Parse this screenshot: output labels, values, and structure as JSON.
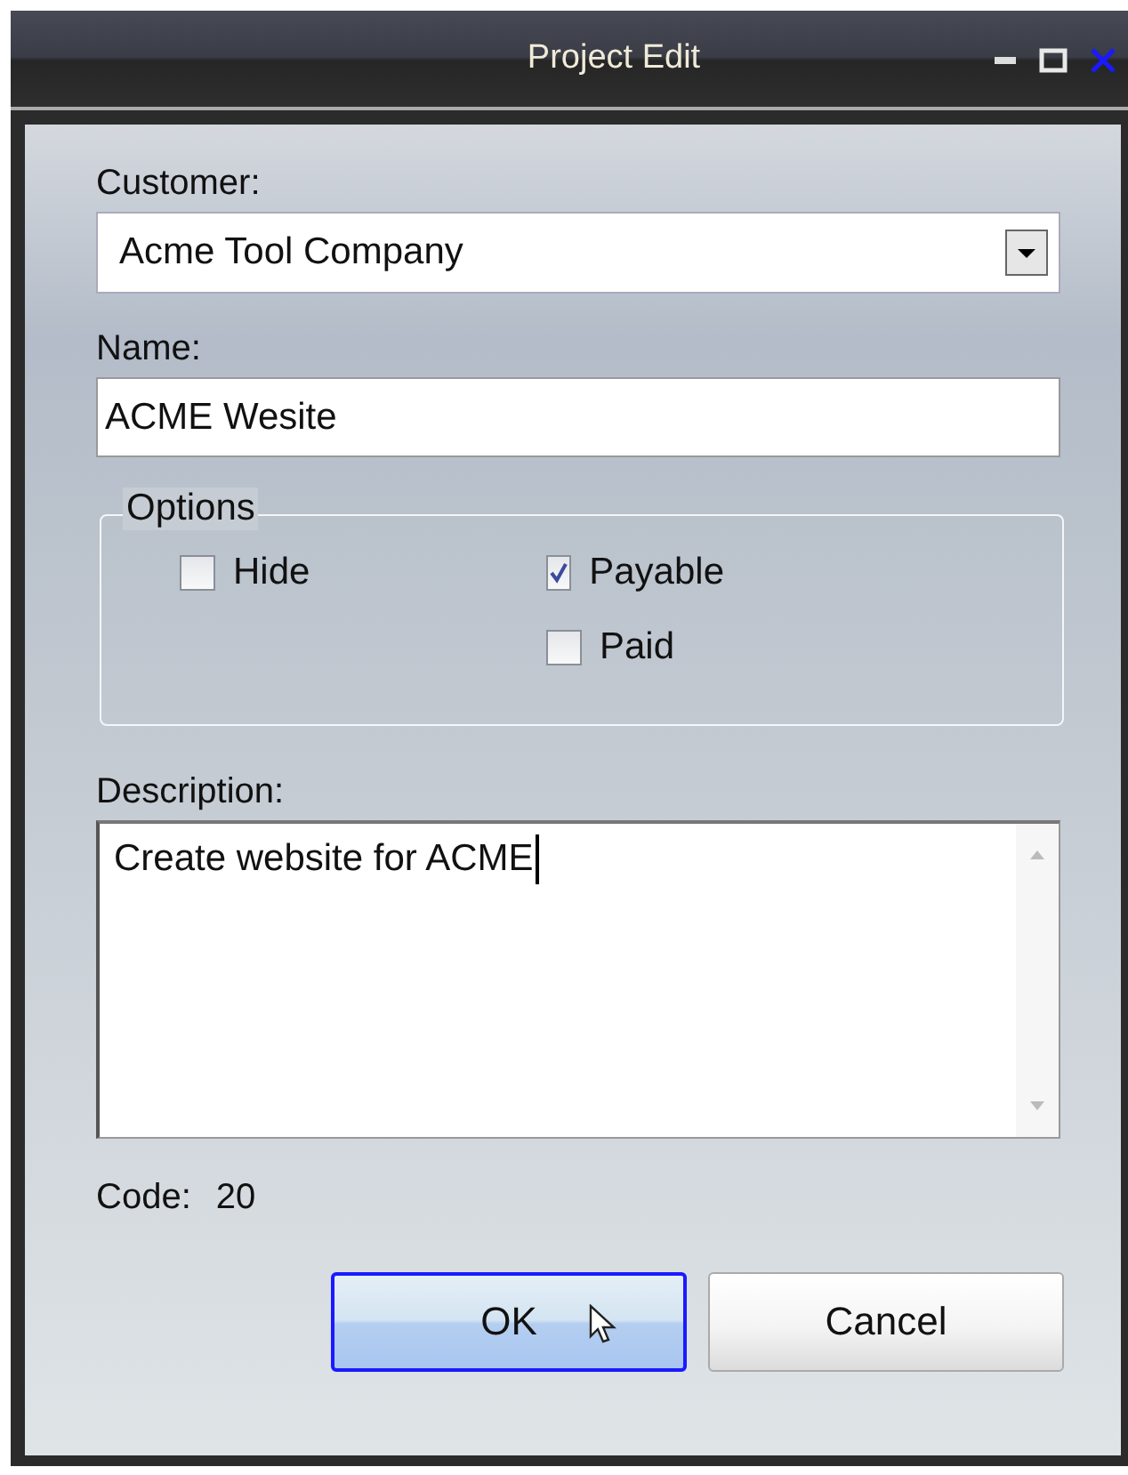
{
  "window": {
    "title": "Project Edit"
  },
  "customer": {
    "label": "Customer:",
    "value": "Acme Tool Company"
  },
  "name": {
    "label": "Name:",
    "value": "ACME Wesite"
  },
  "options": {
    "title": "Options",
    "columns": [
      {
        "items": [
          {
            "label": "Hide",
            "checked": false
          }
        ]
      },
      {
        "items": [
          {
            "label": "Payable",
            "checked": true
          },
          {
            "label": "Paid",
            "checked": false
          }
        ]
      }
    ]
  },
  "description": {
    "label": "Description:",
    "value": "Create website for ACME"
  },
  "code": {
    "label": "Code:",
    "value": "20"
  },
  "buttons": [
    {
      "label": "OK",
      "focused": true
    },
    {
      "label": "Cancel",
      "focused": false
    }
  ]
}
